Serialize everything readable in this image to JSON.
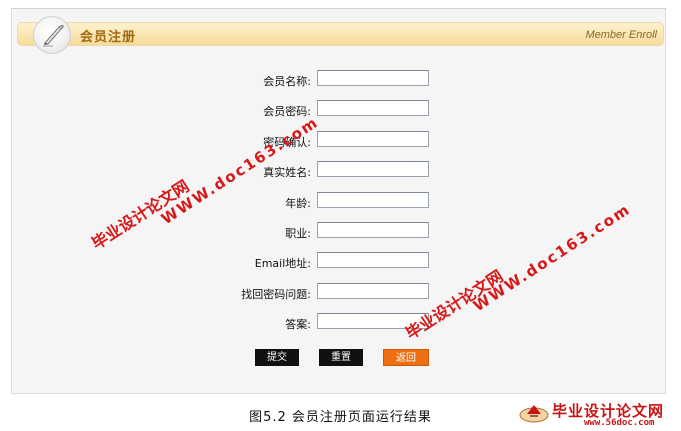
{
  "header": {
    "title": "会员注册",
    "subtitle": "Member Enroll"
  },
  "form": {
    "fields": [
      {
        "label": "会员名称:",
        "value": ""
      },
      {
        "label": "会员密码:",
        "value": ""
      },
      {
        "label": "密码确认:",
        "value": ""
      },
      {
        "label": "真实姓名:",
        "value": ""
      },
      {
        "label": "年龄:",
        "value": ""
      },
      {
        "label": "职业:",
        "value": ""
      },
      {
        "label": "Email地址:",
        "value": ""
      },
      {
        "label": "找回密码问题:",
        "value": ""
      },
      {
        "label": "答案:",
        "value": ""
      }
    ],
    "buttons": {
      "submit": "提交",
      "reset": "重置",
      "back": "返回"
    }
  },
  "watermarks": {
    "site_name": "毕业设计论文网",
    "site_url": "WWW.doc163.com"
  },
  "caption": "图5.2 会员注册页面运行结果",
  "corner_logo": {
    "name": "毕业设计论文网",
    "url": "www.56doc.com"
  },
  "colors": {
    "header_gradient_top": "#fdf1cf",
    "header_gradient_bottom": "#f6dc9b",
    "back_button": "#ee6f12",
    "watermark": "#d81818"
  }
}
